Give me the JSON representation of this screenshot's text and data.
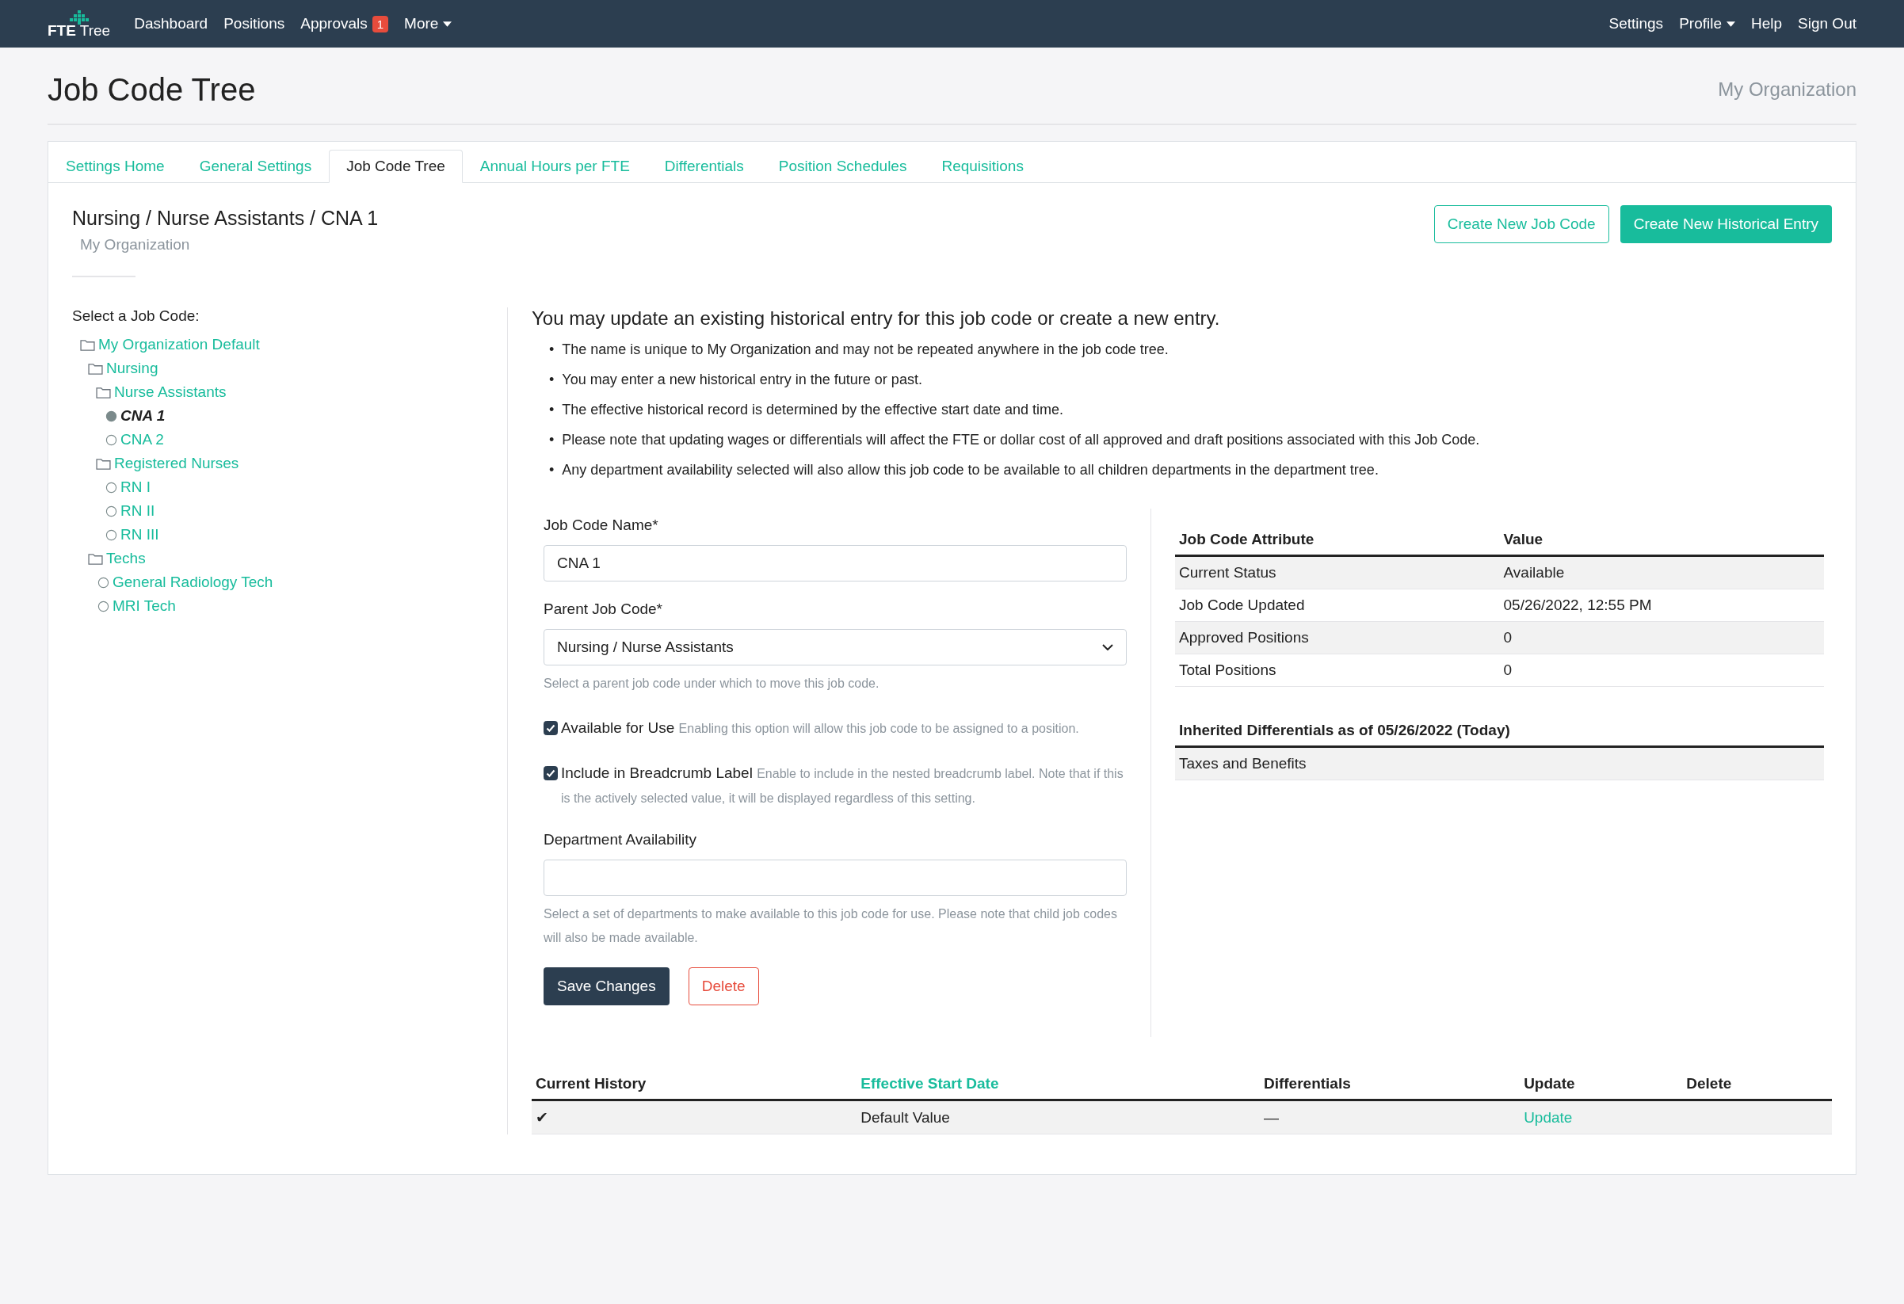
{
  "navbar": {
    "logo": "**FTE** Tree",
    "left": [
      {
        "label": "Dashboard",
        "dropdown": false
      },
      {
        "label": "Positions",
        "dropdown": false
      },
      {
        "label": "Approvals",
        "badge": "1",
        "dropdown": false
      },
      {
        "label": "More",
        "dropdown": true
      }
    ],
    "right": [
      {
        "label": "Settings",
        "dropdown": false
      },
      {
        "label": "Profile",
        "dropdown": true
      },
      {
        "label": "Help",
        "dropdown": false
      },
      {
        "label": "Sign Out",
        "dropdown": false
      }
    ]
  },
  "page": {
    "title": "Job Code Tree",
    "organization": "My Organization"
  },
  "tabs": [
    {
      "label": "Settings Home",
      "selected": false
    },
    {
      "label": "General Settings",
      "selected": false
    },
    {
      "label": "Job Code Tree",
      "selected": true
    },
    {
      "label": "Annual Hours per FTE",
      "selected": false
    },
    {
      "label": "Differentials",
      "selected": false
    },
    {
      "label": "Position Schedules",
      "selected": false
    },
    {
      "label": "Requisitions",
      "selected": false
    }
  ],
  "breadcrumb": {
    "path": "Nursing / Nurse Assistants / CNA 1",
    "organization": "My Organization"
  },
  "header_buttons": [
    {
      "label": "Create New Job Code",
      "kind": "outline"
    },
    {
      "label": "Create New Historical Entry",
      "kind": "solid"
    }
  ],
  "tree": {
    "label": "Select a Job Code:",
    "items": [
      {
        "label": "My Organization Default",
        "kind": "folder",
        "selected": false,
        "children": [
          {
            "label": "Nursing",
            "kind": "folder",
            "selected": false,
            "children": [
              {
                "label": "Nurse Assistants",
                "kind": "folder",
                "selected": false,
                "children": [
                  {
                    "label": "CNA 1",
                    "kind": "code",
                    "selected": true
                  },
                  {
                    "label": "CNA 2",
                    "kind": "code",
                    "selected": false
                  }
                ]
              },
              {
                "label": "Registered Nurses",
                "kind": "folder",
                "selected": false,
                "children": [
                  {
                    "label": "RN I",
                    "kind": "code",
                    "selected": false
                  },
                  {
                    "label": "RN II",
                    "kind": "code",
                    "selected": false
                  },
                  {
                    "label": "RN III",
                    "kind": "code",
                    "selected": false
                  }
                ]
              }
            ]
          },
          {
            "label": "Techs",
            "kind": "folder",
            "selected": false,
            "children": [
              {
                "label": "General Radiology Tech",
                "kind": "code",
                "selected": false
              },
              {
                "label": "MRI Tech",
                "kind": "code",
                "selected": false
              }
            ]
          }
        ]
      }
    ]
  },
  "intro": {
    "heading": "You may update an existing historical entry for this job code or create a new entry.",
    "bullets": [
      {
        "marker": "•",
        "text": "The name is unique to My Organization and may not be repeated anywhere in the job code tree."
      },
      {
        "marker": "•",
        "text": "You may enter a new historical entry in the future or past."
      },
      {
        "marker": "•",
        "text": "The effective historical record is determined by the effective start date and time."
      },
      {
        "marker": "•",
        "text": "Please note that updating wages or differentials will affect the FTE or dollar cost of all approved and draft positions associated with this Job Code."
      },
      {
        "marker": "•",
        "text": "Any department availability selected will also allow this job code to be available to all children departments in the department tree."
      }
    ]
  },
  "form": {
    "name": {
      "label": "Job Code Name*",
      "value": "CNA 1"
    },
    "parent": {
      "label": "Parent Job Code*",
      "value": "Nursing / Nurse Assistants",
      "help": "Select a parent job code under which to move this job code."
    },
    "checkboxes": [
      {
        "label": "Available for Use",
        "help": "Enabling this option will allow this job code to be assigned to a position.",
        "checked": true
      },
      {
        "label": "Include in Breadcrumb Label",
        "help": "Enable to include in the nested breadcrumb label. Note that if this is the actively selected value, it will be displayed regardless of this setting.",
        "checked": true
      }
    ],
    "departments": {
      "label": "Department Availability",
      "help": "Select a set of departments to make available to this job code for use. Please note that child job codes will also be made available."
    },
    "buttons": [
      {
        "label": "Save Changes",
        "kind": "primary"
      },
      {
        "label": "Delete",
        "kind": "danger"
      }
    ]
  },
  "attributes": {
    "columns": [
      "Job Code Attribute",
      "Value"
    ],
    "rows": [
      [
        "Current Status",
        "Available"
      ],
      [
        "Job Code Updated",
        "05/26/2022, 12:55 PM"
      ],
      [
        "Approved Positions",
        "0"
      ],
      [
        "Total Positions",
        "0"
      ]
    ]
  },
  "differentials": {
    "title": "Inherited Differentials as of 05/26/2022 (Today)",
    "rows": [
      "Taxes and Benefits"
    ]
  },
  "history": {
    "columns": [
      {
        "label": "Current History",
        "sortable": false
      },
      {
        "label": "Effective Start Date",
        "sortable": true
      },
      {
        "label": "Differentials",
        "sortable": false
      },
      {
        "label": "Update",
        "sortable": false
      },
      {
        "label": "Delete",
        "sortable": false
      }
    ],
    "rows": [
      {
        "current": "✔",
        "effective_start": "Default Value",
        "differentials": "—",
        "update": "Update"
      }
    ]
  }
}
